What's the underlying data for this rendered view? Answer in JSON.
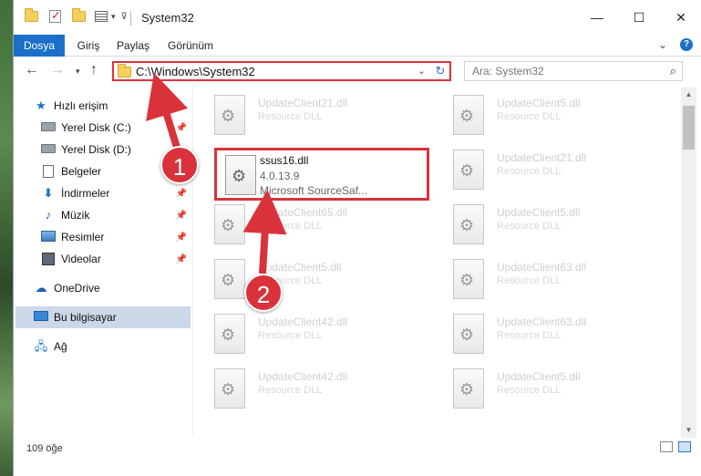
{
  "window": {
    "title": "System32",
    "controls": {
      "minimize": "—",
      "maximize": "☐",
      "close": "✕"
    }
  },
  "ribbon": {
    "tabs": [
      "Dosya",
      "Giriş",
      "Paylaş",
      "Görünüm"
    ]
  },
  "address": {
    "path": "C:\\Windows\\System32",
    "search_placeholder": "Ara: System32"
  },
  "nav": {
    "quick_access": "Hızlı erişim",
    "items": [
      {
        "label": "Yerel Disk (C:)",
        "icon": "disk-icon",
        "pinned": true
      },
      {
        "label": "Yerel Disk (D:)",
        "icon": "disk-icon",
        "pinned": false
      },
      {
        "label": "Belgeler",
        "icon": "documents-icon",
        "pinned": true
      },
      {
        "label": "İndirmeler",
        "icon": "download-icon",
        "pinned": true
      },
      {
        "label": "Müzik",
        "icon": "music-icon",
        "pinned": true
      },
      {
        "label": "Resimler",
        "icon": "pictures-icon",
        "pinned": true
      },
      {
        "label": "Videolar",
        "icon": "videos-icon",
        "pinned": true
      }
    ],
    "onedrive": "OneDrive",
    "this_pc": "Bu bilgisayar",
    "network": "Ağ"
  },
  "files": {
    "left": [
      {
        "name": "UpdateClient21.dll",
        "type": "Resource DLL"
      },
      {
        "name": "ssus16.dll",
        "version": "4.0.13.9",
        "desc": "Microsoft SourceSaf...",
        "highlighted": true
      },
      {
        "name": "UpdateClient65.dll",
        "type": "Resource DLL"
      },
      {
        "name": "UpdateClient5.dll",
        "type": "Resource DLL"
      },
      {
        "name": "UpdateClient42.dll",
        "type": "Resource DLL"
      },
      {
        "name": "UpdateClient42.dll",
        "type": "Resource DLL"
      }
    ],
    "right": [
      {
        "name": "UpdateClient5.dll",
        "type": "Resource DLL"
      },
      {
        "name": "UpdateClient21.dll",
        "type": "Resource DLL"
      },
      {
        "name": "UpdateClient5.dll",
        "type": "Resource DLL"
      },
      {
        "name": "UpdateClient63.dll",
        "type": "Resource DLL"
      },
      {
        "name": "UpdateClient63.dll",
        "type": "Resource DLL"
      },
      {
        "name": "UpdateClient5.dll",
        "type": "Resource DLL"
      }
    ]
  },
  "status": {
    "count": "109 öğe"
  },
  "annotations": {
    "step1": "1",
    "step2": "2"
  },
  "colors": {
    "accent": "#1a6fc9",
    "annotation_red": "#d9323b"
  }
}
